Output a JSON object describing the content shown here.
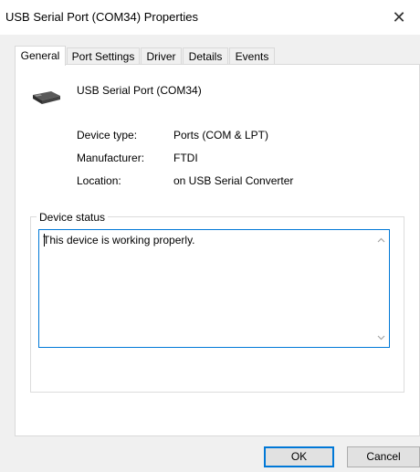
{
  "window": {
    "title": "USB Serial Port (COM34) Properties",
    "close_glyph": "✕"
  },
  "tabs": [
    {
      "label": "General",
      "active": true
    },
    {
      "label": "Port Settings",
      "active": false
    },
    {
      "label": "Driver",
      "active": false
    },
    {
      "label": "Details",
      "active": false
    },
    {
      "label": "Events",
      "active": false
    }
  ],
  "device": {
    "name": "USB Serial Port (COM34)",
    "icon": "usb-connector-icon"
  },
  "properties": [
    {
      "label": "Device type:",
      "value": "Ports (COM & LPT)"
    },
    {
      "label": "Manufacturer:",
      "value": "FTDI"
    },
    {
      "label": "Location:",
      "value": "on USB Serial Converter"
    }
  ],
  "device_status": {
    "group_title": "Device status",
    "text": "This device is working properly."
  },
  "buttons": {
    "ok": "OK",
    "cancel": "Cancel"
  },
  "colors": {
    "accent": "#0078d7",
    "window_bg": "#f0f0f0",
    "panel_bg": "#ffffff"
  }
}
